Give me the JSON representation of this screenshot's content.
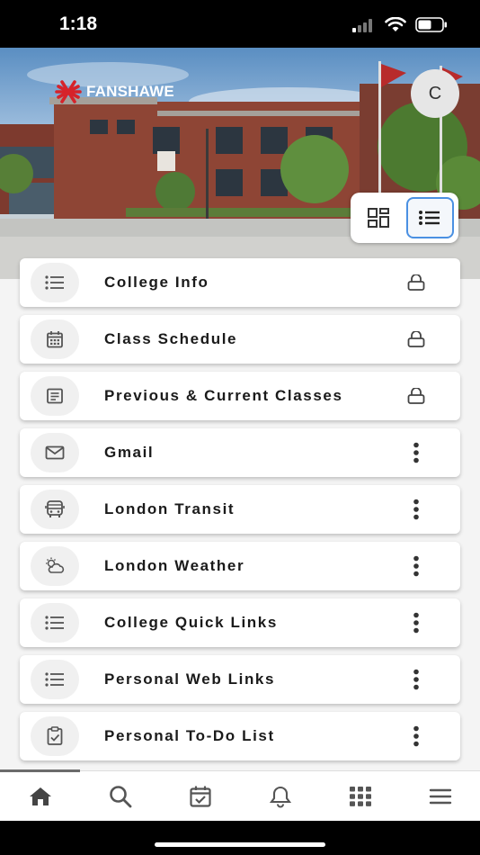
{
  "status_bar": {
    "time": "1:18"
  },
  "header": {
    "logo_text": "FANSHAWE",
    "avatar_initial": "C",
    "view_modes": [
      {
        "name": "grid",
        "icon": "grid-icon",
        "active": false
      },
      {
        "name": "list",
        "icon": "list-icon",
        "active": true
      }
    ]
  },
  "cards": [
    {
      "label": "College Info",
      "icon": "list-icon",
      "action": "lock-icon"
    },
    {
      "label": "Class Schedule",
      "icon": "calendar-icon",
      "action": "lock-icon"
    },
    {
      "label": "Previous & Current Classes",
      "icon": "document-icon",
      "action": "lock-icon"
    },
    {
      "label": "Gmail",
      "icon": "envelope-icon",
      "action": "more-vertical-icon"
    },
    {
      "label": "London Transit",
      "icon": "bus-icon",
      "action": "more-vertical-icon"
    },
    {
      "label": "London Weather",
      "icon": "cloud-sun-icon",
      "action": "more-vertical-icon"
    },
    {
      "label": "College Quick Links",
      "icon": "list-icon",
      "action": "more-vertical-icon"
    },
    {
      "label": "Personal Web Links",
      "icon": "list-icon",
      "action": "more-vertical-icon"
    },
    {
      "label": "Personal To-Do List",
      "icon": "clipboard-check-icon",
      "action": "more-vertical-icon"
    }
  ],
  "bottom_nav": [
    {
      "name": "home",
      "icon": "home-icon",
      "active": true
    },
    {
      "name": "search",
      "icon": "search-icon",
      "active": false
    },
    {
      "name": "calendar",
      "icon": "calendar-check-icon",
      "active": false
    },
    {
      "name": "notifications",
      "icon": "bell-icon",
      "active": false
    },
    {
      "name": "apps",
      "icon": "apps-grid-icon",
      "active": false
    },
    {
      "name": "menu",
      "icon": "hamburger-menu-icon",
      "active": false
    }
  ],
  "colors": {
    "brand_red": "#d6232a",
    "accent_blue": "#4a90e2",
    "icon_gray": "#555555"
  }
}
